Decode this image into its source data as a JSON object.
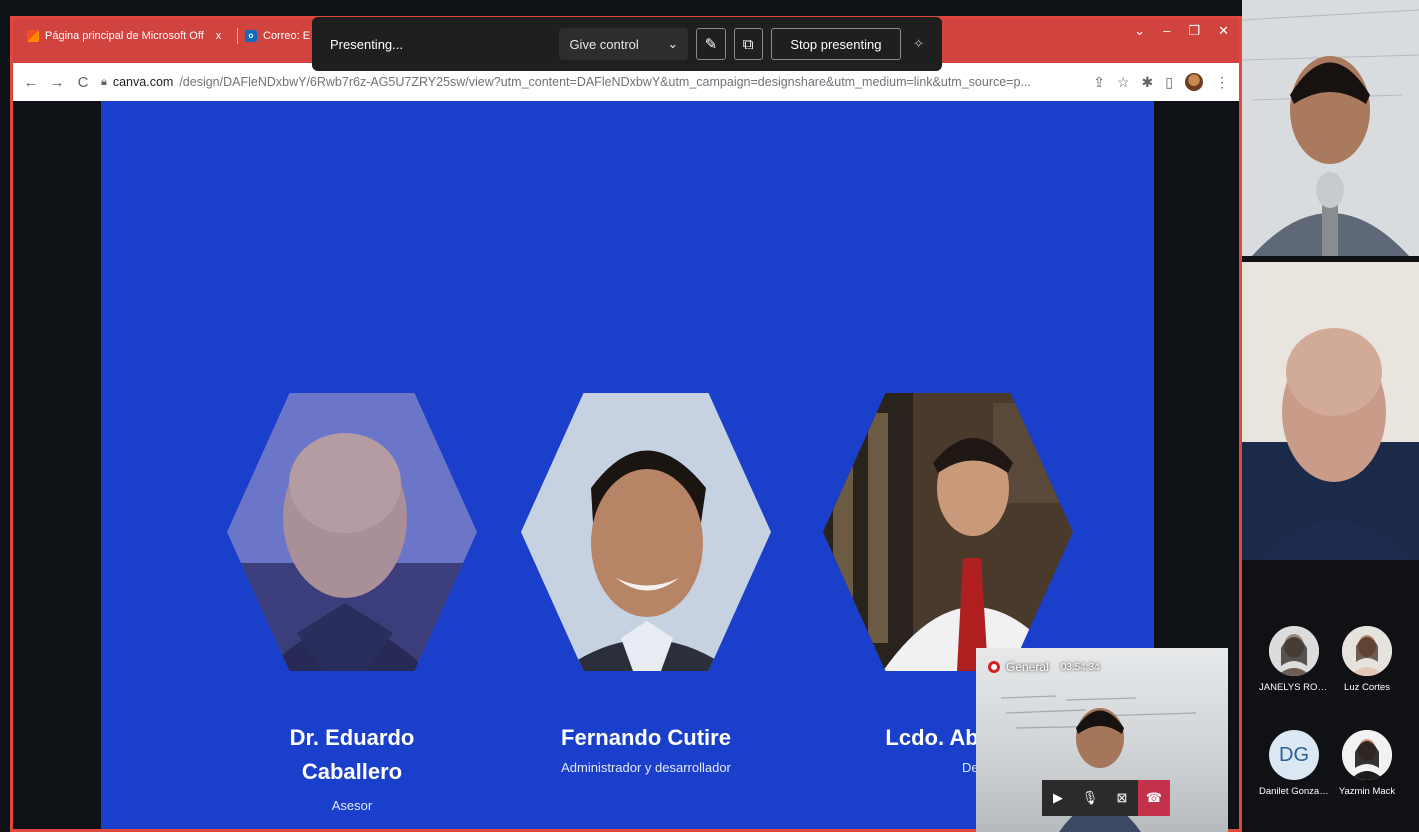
{
  "browser": {
    "tabs": [
      {
        "label": "Página principal de Microsoft Off",
        "icon": "office-icon"
      },
      {
        "label": "Correo: E",
        "icon": "outlook-icon"
      }
    ],
    "tab_close": "x",
    "url_domain": "canva.com",
    "url_path": "/design/DAFleNDxbwY/6Rwb7r6z-AG5U7ZRY25sw/view?utm_content=DAFleNDxbwY&utm_campaign=designshare&utm_medium=link&utm_source=p..."
  },
  "presenting_bar": {
    "status": "Presenting...",
    "give_control": "Give control",
    "stop": "Stop presenting"
  },
  "slide": {
    "members": [
      {
        "name_line1": "Dr. Eduardo",
        "name_line2": "Caballero",
        "role": "Asesor"
      },
      {
        "name_line1": "Fernando Cutire",
        "name_line2": "",
        "role": "Administrador y desarrollador"
      },
      {
        "name_line1": "Lcdo. Abdiel",
        "name_line2": "",
        "role": "Desarrollador"
      }
    ]
  },
  "mini_call": {
    "channel": "General",
    "timer": "03:54:34"
  },
  "participants": [
    {
      "name": "JANELYS RODRIG...",
      "initials": ""
    },
    {
      "name": "Luz Cortes",
      "initials": ""
    },
    {
      "name": "Danilet Gonzalez",
      "initials": "DG"
    },
    {
      "name": "Yazmin Mack",
      "initials": ""
    }
  ],
  "colors": {
    "slide_bg": "#1a3fcb",
    "tabbar": "#d0433f",
    "hangup": "#c4314b"
  }
}
